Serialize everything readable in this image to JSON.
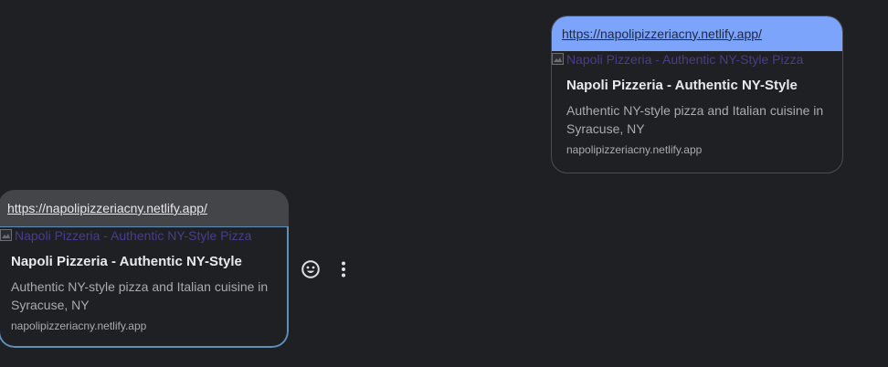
{
  "messages": [
    {
      "url": "https://napolipizzeriacny.netlify.app/",
      "image_alt": "Napoli Pizzeria - Authentic NY-Style Pizza",
      "title": "Napoli Pizzeria - Authentic NY-Style",
      "description": "Authentic NY-style pizza and Italian cuisine in Syracuse, NY",
      "domain": "napolipizzeriacny.netlify.app"
    },
    {
      "url": "https://napolipizzeriacny.netlify.app/",
      "image_alt": "Napoli Pizzeria - Authentic NY-Style Pizza",
      "title": "Napoli Pizzeria - Authentic NY-Style",
      "description": "Authentic NY-style pizza and Italian cuisine in Syracuse, NY",
      "domain": "napolipizzeriacny.netlify.app"
    }
  ],
  "actions": {
    "react_icon": "smiley-face-icon",
    "more_icon": "vertical-dots-icon"
  },
  "colors": {
    "background": "#1f2023",
    "sent_url_band": "#7ca4fb",
    "received_url_band": "#444548",
    "selected_border": "#5f8fb8"
  }
}
